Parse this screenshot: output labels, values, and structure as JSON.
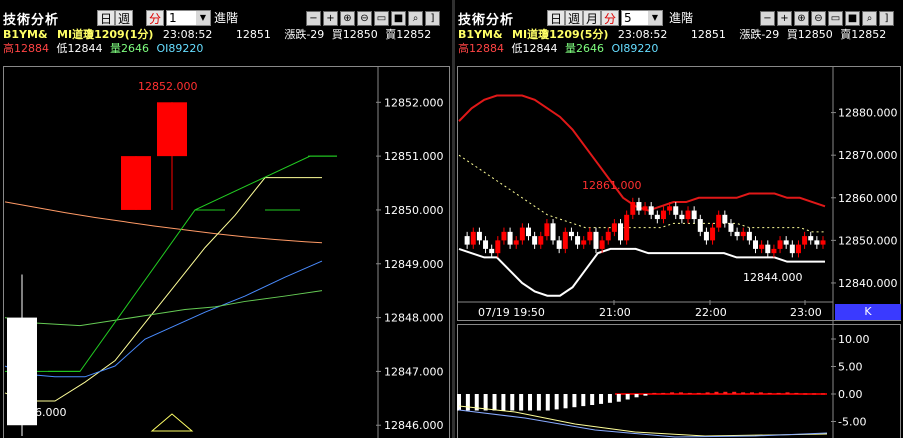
{
  "left": {
    "title": "技術分析",
    "period_buttons": [
      "日",
      "週",
      "分"
    ],
    "interval_value": "1",
    "go_label": "進階",
    "tool_icons": [
      "minus-icon",
      "plus-icon",
      "zoom-in-icon",
      "zoom-out-icon",
      "chart-window-icon",
      "save-icon",
      "search-icon",
      "bracket-icon"
    ],
    "tool_glyphs": [
      "−",
      "+",
      "⊕",
      "⊖",
      "▭",
      "■",
      "⌕",
      "]"
    ],
    "info": {
      "symbol": "B1YM&",
      "contract": "MI道瓊1209(1分)",
      "time": "23:08:52",
      "price": "12851",
      "change": "漲跌-29",
      "bid": "買12850",
      "ask": "賣12852",
      "high": "高12884",
      "low": "低12844",
      "volume": "量2646",
      "oi": "OI89220"
    },
    "annotations": {
      "high_label": "12852.000",
      "low_label": "12846.000"
    }
  },
  "right": {
    "title": "技術分析",
    "period_buttons": [
      "日",
      "週",
      "月",
      "分"
    ],
    "interval_value": "5",
    "go_label": "進階",
    "tool_icons": [
      "minus-icon",
      "plus-icon",
      "zoom-in-icon",
      "zoom-out-icon",
      "chart-window-icon",
      "save-icon",
      "search-icon",
      "bracket-icon"
    ],
    "tool_glyphs": [
      "−",
      "+",
      "⊕",
      "⊖",
      "▭",
      "■",
      "⌕",
      "]"
    ],
    "info": {
      "symbol": "B1YM&",
      "contract": "MI道瓊1209(5分)",
      "time": "23:08:52",
      "price": "12851",
      "change": "漲跌-29",
      "bid": "買12850",
      "ask": "賣12852",
      "high": "高12884",
      "low": "低12844",
      "volume": "量2646",
      "oi": "OI89220"
    },
    "annotations": {
      "high_label": "12861.000",
      "low_label": "12844.000"
    },
    "k_button": "K"
  },
  "colors": {
    "up": "#ff0000",
    "down": "#ffffff",
    "bollinger": "#e01818",
    "grid": "#555555",
    "axis_text": "#ffffff"
  },
  "chart_data": [
    {
      "type": "candlestick",
      "name": "1-minute",
      "ylim": [
        12845.8,
        12852.6
      ],
      "yticks": [
        12852,
        12851,
        12850,
        12849,
        12848,
        12847,
        12846
      ],
      "ytick_labels": [
        "12852.000",
        "12851.000",
        "12850.000",
        "12849.000",
        "12848.000",
        "12847.000",
        "12846.000"
      ],
      "candles": [
        {
          "open": 12848,
          "close": 12846,
          "high": 12848.8,
          "low": 12845.8
        },
        {
          "open": 12850,
          "close": 12851,
          "high": 12851,
          "low": 12850
        },
        {
          "open": 12851,
          "close": 12852,
          "high": 12852,
          "low": 12850
        }
      ],
      "lines": [
        {
          "color": "#ff9a66",
          "values": [
            12850.15,
            12850.05,
            12849.95,
            12849.86,
            12849.78,
            12849.7,
            12849.63,
            12849.56,
            12849.5,
            12849.45,
            12849.41,
            12849.39
          ]
        },
        {
          "color": "#ffff99",
          "values": [
            12846.6,
            12846.45,
            12846.45,
            12846.8,
            12847.2,
            12847.9,
            12848.6,
            12849.3,
            12849.9,
            12850.6,
            12850.6
          ]
        },
        {
          "color": "#4a8cff",
          "values": [
            12847.1,
            12846.95,
            12846.9,
            12846.9,
            12847.1,
            12847.6,
            12847.85,
            12848.1,
            12848.4,
            12848.75,
            12849.05
          ]
        },
        {
          "color": "#66cc55",
          "values": [
            12848.0,
            12847.9,
            12847.85,
            12847.95,
            12848.05,
            12848.15,
            12848.2,
            12848.3,
            12848.4,
            12848.5
          ]
        },
        {
          "color": "#22cc22",
          "values": [
            12847.0,
            12847.0,
            12847.0,
            12850.0,
            12851.0,
            12851.0
          ]
        }
      ]
    },
    {
      "type": "candlestick",
      "name": "5-minute",
      "ylim": [
        12836,
        12890
      ],
      "yticks": [
        12880,
        12870,
        12860,
        12850,
        12840
      ],
      "ytick_labels": [
        "12880.000",
        "12870.000",
        "12860.000",
        "12850.000",
        "12840.000"
      ],
      "xtick_labels": [
        "07/19 19:50",
        "21:00",
        "22:00",
        "23:00"
      ],
      "closes": [
        12851,
        12849,
        12852,
        12850,
        12848,
        12847,
        12850,
        12852,
        12849,
        12850,
        12853,
        12851,
        12849,
        12851,
        12854,
        12850,
        12848,
        12852,
        12851,
        12849,
        12850,
        12852,
        12848,
        12850,
        12852,
        12854,
        12850,
        12856,
        12859,
        12857,
        12858,
        12856,
        12855,
        12857,
        12858,
        12856,
        12855,
        12857,
        12855,
        12852,
        12850,
        12853,
        12856,
        12854,
        12852,
        12851,
        12852,
        12850,
        12848,
        12849,
        12847,
        12848,
        12850,
        12849,
        12847,
        12849,
        12851,
        12850,
        12849,
        12850
      ],
      "bollinger_upper": [
        12878,
        12881,
        12883,
        12884,
        12884,
        12884,
        12883,
        12881,
        12879,
        12876,
        12872,
        12868,
        12864,
        12860,
        12858,
        12857,
        12858,
        12859,
        12859,
        12860,
        12860,
        12860,
        12860,
        12861,
        12861,
        12861,
        12860,
        12860,
        12859,
        12858
      ],
      "bollinger_lower": [
        12848,
        12847,
        12846,
        12846,
        12843,
        12840,
        12838,
        12837,
        12837,
        12839,
        12843,
        12847,
        12848,
        12848,
        12848,
        12847,
        12847,
        12847,
        12847,
        12847,
        12847,
        12847,
        12846,
        12846,
        12846,
        12846,
        12845,
        12845,
        12845,
        12845
      ],
      "ma_dotted": [
        12870,
        12868,
        12866,
        12864,
        12862,
        12860,
        12858,
        12856,
        12855,
        12854,
        12853,
        12853,
        12853,
        12853,
        12853,
        12853,
        12853,
        12854,
        12854,
        12854,
        12854,
        12854,
        12854,
        12853,
        12853,
        12853,
        12853,
        12853,
        12852,
        12852
      ],
      "indicator": {
        "yticks": [
          10,
          5,
          0,
          -5
        ],
        "ytick_labels": [
          "10.00",
          "5.00",
          "0.00",
          "-5.00"
        ],
        "ylim": [
          -8,
          12
        ],
        "histogram": [
          -3,
          -3,
          -3,
          -3,
          -3,
          -3,
          -3,
          -3,
          -3,
          -3,
          -3,
          -2.8,
          -2.6,
          -2.4,
          -2.2,
          -2,
          -1.8,
          -1.6,
          -1.4,
          -1,
          -0.6,
          -0.3,
          0.2,
          0.2,
          0.3,
          0.3,
          0.2,
          0.2,
          0.3,
          0.4,
          0.4,
          0.4,
          0.3,
          0.3,
          0.3,
          0.2,
          0.2,
          0.3,
          0.2,
          0.1,
          0.1,
          0.1
        ]
      }
    }
  ]
}
